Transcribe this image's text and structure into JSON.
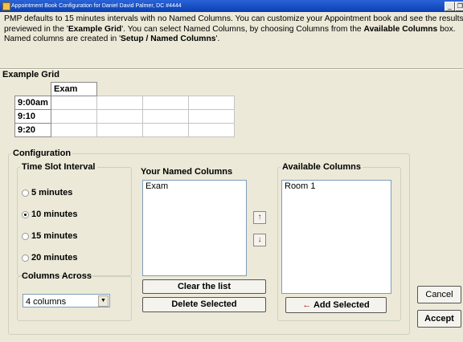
{
  "window": {
    "title": "Appointment Book Configuration for Daniel David Palmer, DC #4444",
    "minimize_glyph": "_",
    "restore_glyph": "❐"
  },
  "intro": {
    "part1": "PMP defaults to 15 minutes intervals with no Named Columns. You can customize your Appointment book and see the results previewed in the '",
    "bold1": "Example Grid",
    "part2": "'. You can select Named Columns, by choosing Columns from the ",
    "bold2": "Available Columns",
    "part3": " box. Named columns are created in '",
    "bold3": "Setup / Named Columns",
    "part4": "'."
  },
  "example_grid": {
    "title": "Example Grid",
    "columns": [
      "Exam",
      "",
      "",
      ""
    ],
    "rows": [
      "9:00am",
      "9:10",
      "9:20"
    ]
  },
  "configuration": {
    "title": "Configuration",
    "time_slot": {
      "title": "Time Slot Interval",
      "options": [
        "5 minutes",
        "10 minutes",
        "15 minutes",
        "20 minutes"
      ],
      "selected": "10 minutes"
    },
    "columns_across": {
      "title": "Columns Across",
      "value": "4 columns"
    },
    "named_columns": {
      "title": "Your Named Columns",
      "items": [
        "Exam"
      ],
      "clear_label": "Clear the list",
      "delete_label": "Delete Selected",
      "up_icon": "↑",
      "down_icon": "↓"
    },
    "available_columns": {
      "title": "Available Columns",
      "items": [
        "Room 1"
      ],
      "add_icon": "←",
      "add_label": "Add Selected"
    }
  },
  "buttons": {
    "cancel": "Cancel",
    "accept": "Accept"
  }
}
